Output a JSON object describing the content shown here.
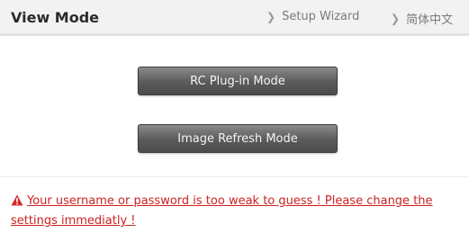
{
  "header": {
    "title": "View Mode",
    "links": [
      {
        "label": "Setup Wizard",
        "icon": "chevron-right-icon"
      },
      {
        "label": "简体中文",
        "icon": "chevron-right-icon"
      }
    ]
  },
  "buttons": {
    "rc_plugin": "RC Plug-in Mode",
    "image_refresh": "Image Refresh Mode"
  },
  "warning": {
    "icon": "warning-icon",
    "text": "Your username or password is too weak to guess ! Please change the settings immediatly !",
    "color": "#cc2222"
  }
}
